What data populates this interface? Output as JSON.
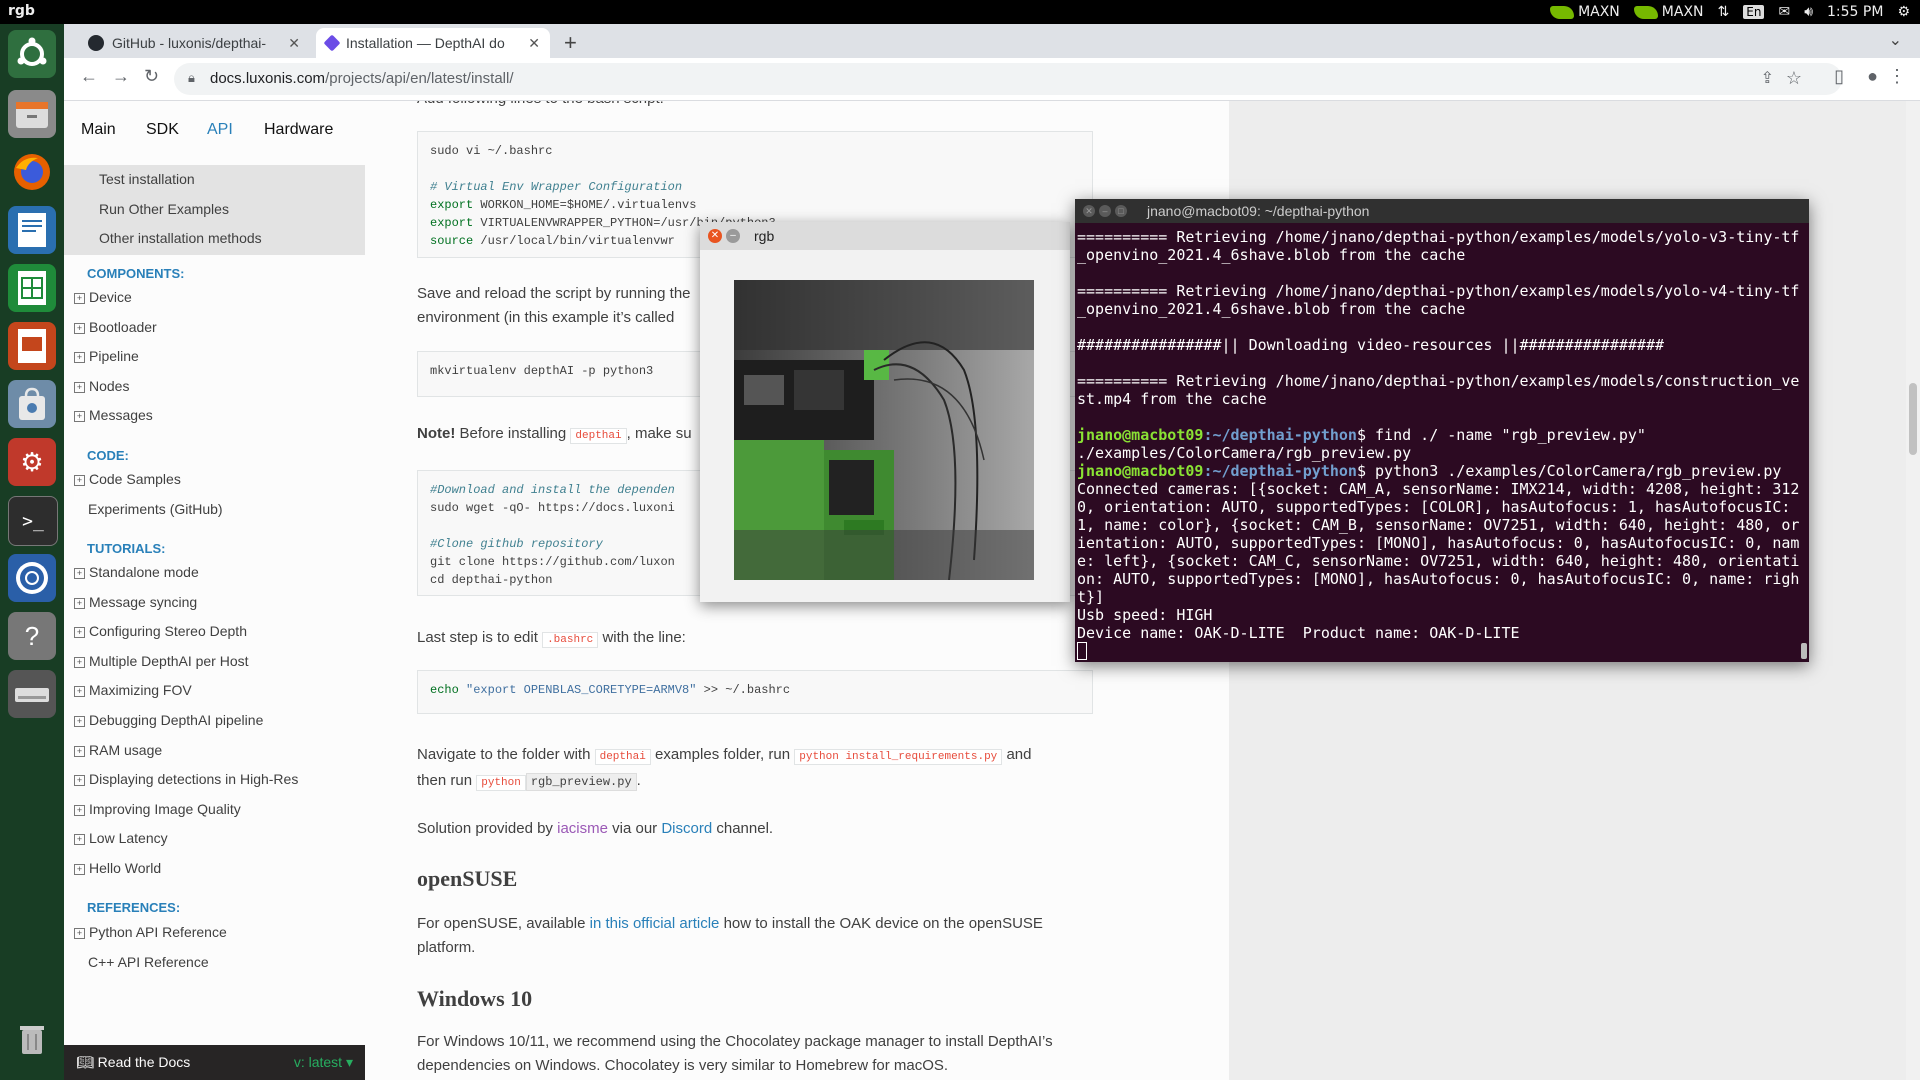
{
  "topbar": {
    "app_name": "rgb",
    "nvidia_1": "MAXN",
    "nvidia_2": "MAXN",
    "lang": "En",
    "time": "1:55 PM"
  },
  "browser": {
    "tabs": [
      {
        "title": "GitHub - luxonis/depthai-"
      },
      {
        "title": "Installation — DepthAI do"
      }
    ],
    "url_host": "docs.luxonis.com",
    "url_path": "/projects/api/en/latest/install/"
  },
  "docs": {
    "top_nav": [
      "Main",
      "SDK",
      "API",
      "Hardware"
    ],
    "sidebar": {
      "install_sub": [
        "Test installation",
        "Run Other Examples",
        "Other installation methods"
      ],
      "components_caption": "COMPONENTS:",
      "components": [
        "Device",
        "Bootloader",
        "Pipeline",
        "Nodes",
        "Messages"
      ],
      "code_caption": "CODE:",
      "code_samples": "Code Samples",
      "experiments": "Experiments (GitHub)",
      "tutorials_caption": "TUTORIALS:",
      "tutorials": [
        "Standalone mode",
        "Message syncing",
        "Configuring Stereo Depth",
        "Multiple DepthAI per Host",
        "Maximizing FOV",
        "Debugging DepthAI pipeline",
        "RAM usage",
        "Displaying detections in High-Res",
        "Improving Image Quality",
        "Low Latency",
        "Hello World"
      ],
      "references_caption": "REFERENCES:",
      "python_ref": "Python API Reference",
      "cpp_ref": "C++ API Reference",
      "rtd_label": "Read the Docs",
      "rtd_version": "v: latest"
    },
    "content": {
      "line_top": "Add following lines to the bash script:",
      "code1": {
        "l1": "sudo vi ~/.bashrc",
        "l2": "# Virtual Env Wrapper Configuration",
        "l3a": "export",
        "l3b": " WORKON_HOME=$HOME/.virtualenvs",
        "l4a": "export",
        "l4b": " VIRTUALENVWRAPPER_PYTHON=/usr/bin/python3",
        "l5a": "source",
        "l5b": " /usr/local/bin/virtualenvwr"
      },
      "para_save_1": "Save and reload the script by running the",
      "para_save_2": "environment (in this example it’s called",
      "code2": "mkvirtualenv depthAI -p python3",
      "note_label": "Note!",
      "note_text_1": "Before installing",
      "note_lit": "depthai",
      "note_text_2": ", make su",
      "code3": {
        "l1": "#Download and install the dependen",
        "l2": "sudo wget -qO- https://docs.luxoni",
        "l3": "#Clone github repository",
        "l4": "git clone https://github.com/luxon",
        "l5": "cd depthai-python"
      },
      "last_step_1": "Last step is to edit",
      "last_step_lit": ".bashrc",
      "last_step_2": "with the line:",
      "code4_a": "echo ",
      "code4_b": "\"export OPENBLAS_CORETYPE=ARMV8\"",
      "code4_c": " >> ~/.bashrc",
      "nav_1": "Navigate to the folder with",
      "nav_lit1": "depthai",
      "nav_2": "examples folder, run",
      "nav_lit2": "python install_requirements.py",
      "nav_3": "and",
      "nav_4": "then run",
      "nav_lit3": "python",
      "nav_lit4": "rgb_preview.py",
      "nav_5": ".",
      "sol_1": "Solution provided by",
      "sol_link1": "iacisme",
      "sol_2": "via our",
      "sol_link2": "Discord",
      "sol_3": "channel.",
      "h_opensuse": "openSUSE",
      "os_1": "For openSUSE, available",
      "os_link": "in this official article",
      "os_2": "how to install the OAK device on the openSUSE",
      "os_3": "platform.",
      "h_windows": "Windows 10",
      "win_1": "For Windows 10/11, we recommend using the Chocolatey package manager to install DepthAI’s",
      "win_2": "dependencies on Windows. Chocolatey is very similar to Homebrew for macOS."
    }
  },
  "rgb_window": {
    "title": "rgb"
  },
  "terminal": {
    "title": "jnano@macbot09: ~/depthai-python",
    "lines": {
      "a1": "========== Retrieving /home/jnano/depthai-python/examples/models/yolo-v3-tiny-tf",
      "a2": "_openvino_2021.4_6shave.blob from the cache",
      "b1": "========== Retrieving /home/jnano/depthai-python/examples/models/yolo-v4-tiny-tf",
      "b2": "_openvino_2021.4_6shave.blob from the cache",
      "c1": "################|| Downloading video-resources ||################",
      "d1": "========== Retrieving /home/jnano/depthai-python/examples/models/construction_ve",
      "d2": "st.mp4 from the cache",
      "prompt_user": "jnano@macbot09",
      "prompt_path": ":~/depthai-python",
      "cmd1": "$ find ./ -name \"rgb_preview.py\"",
      "out1": "./examples/ColorCamera/rgb_preview.py",
      "cmd2": "$ python3 ./examples/ColorCamera/rgb_preview.py",
      "o1": "Connected cameras: [{socket: CAM_A, sensorName: IMX214, width: 4208, height: 312",
      "o2": "0, orientation: AUTO, supportedTypes: [COLOR], hasAutofocus: 1, hasAutofocusIC:",
      "o3": "1, name: color}, {socket: CAM_B, sensorName: OV7251, width: 640, height: 480, or",
      "o4": "ientation: AUTO, supportedTypes: [MONO], hasAutofocus: 0, hasAutofocusIC: 0, nam",
      "o5": "e: left}, {socket: CAM_C, sensorName: OV7251, width: 640, height: 480, orientati",
      "o6": "on: AUTO, supportedTypes: [MONO], hasAutofocus: 0, hasAutofocusIC: 0, name: righ",
      "o7": "t}]",
      "o8": "Usb speed: HIGH",
      "o9": "Device name: OAK-D-LITE  Product name: OAK-D-LITE"
    }
  }
}
